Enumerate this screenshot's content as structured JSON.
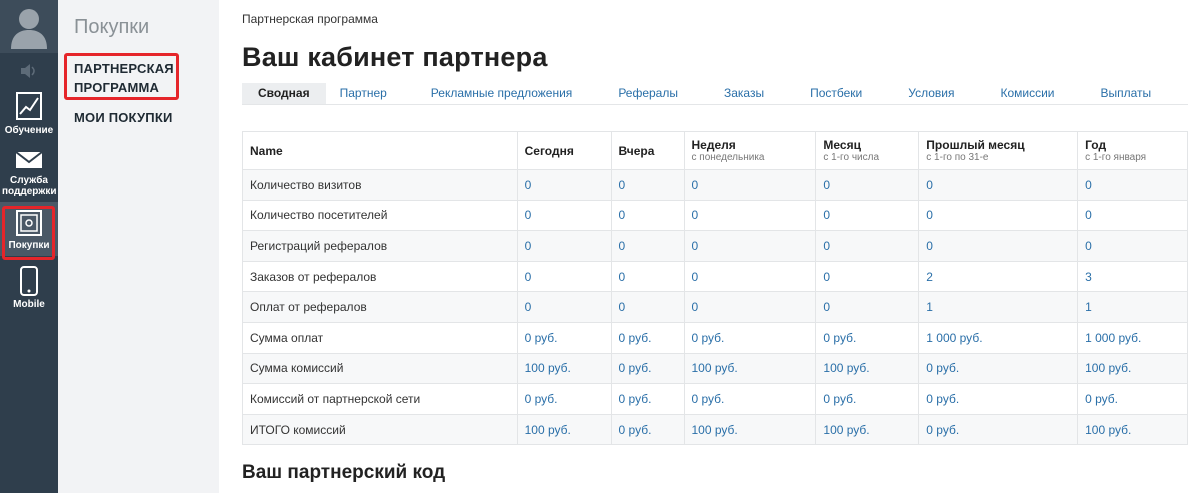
{
  "rail": {
    "items": [
      {
        "label": "Обучение",
        "icon": "chart-icon"
      },
      {
        "label": "Служба поддержки",
        "icon": "envelope-icon"
      },
      {
        "label": "Покупки",
        "icon": "safe-icon"
      },
      {
        "label": "Mobile",
        "icon": "mobile-icon"
      }
    ]
  },
  "sidebar": {
    "title": "Покупки",
    "items": [
      {
        "label_line1": "ПАРТНЕРСКАЯ",
        "label_line2": "ПРОГРАММА"
      },
      {
        "label": "МОИ ПОКУПКИ"
      }
    ]
  },
  "breadcrumb": "Партнерская программа",
  "page_title": "Ваш кабинет партнера",
  "tabs": [
    {
      "label": "Сводная",
      "active": true
    },
    {
      "label": "Партнер"
    },
    {
      "label": "Рекламные предложения"
    },
    {
      "label": "Рефералы"
    },
    {
      "label": "Заказы"
    },
    {
      "label": "Постбеки"
    },
    {
      "label": "Условия"
    },
    {
      "label": "Комиссии"
    },
    {
      "label": "Выплаты"
    }
  ],
  "table": {
    "headers": [
      {
        "label": "Name",
        "sub": ""
      },
      {
        "label": "Сегодня",
        "sub": ""
      },
      {
        "label": "Вчера",
        "sub": ""
      },
      {
        "label": "Неделя",
        "sub": "с понедельника"
      },
      {
        "label": "Месяц",
        "sub": "с 1-го числа"
      },
      {
        "label": "Прошлый месяц",
        "sub": "с 1-го по 31-е"
      },
      {
        "label": "Год",
        "sub": "с 1-го января"
      }
    ],
    "rows": [
      {
        "name": "Количество визитов",
        "values": [
          "0",
          "0",
          "0",
          "0",
          "0",
          "0"
        ]
      },
      {
        "name": "Количество посетителей",
        "values": [
          "0",
          "0",
          "0",
          "0",
          "0",
          "0"
        ]
      },
      {
        "name": "Регистраций рефералов",
        "values": [
          "0",
          "0",
          "0",
          "0",
          "0",
          "0"
        ]
      },
      {
        "name": "Заказов от рефералов",
        "values": [
          "0",
          "0",
          "0",
          "0",
          "2",
          "3"
        ]
      },
      {
        "name": "Оплат от рефералов",
        "values": [
          "0",
          "0",
          "0",
          "0",
          "1",
          "1"
        ]
      },
      {
        "name": "Сумма оплат",
        "values": [
          "0 руб.",
          "0 руб.",
          "0 руб.",
          "0 руб.",
          "1 000 руб.",
          "1 000 руб."
        ]
      },
      {
        "name": "Сумма комиссий",
        "values": [
          "100 руб.",
          "0 руб.",
          "100 руб.",
          "100 руб.",
          "0 руб.",
          "100 руб."
        ]
      },
      {
        "name": "Комиссий от партнерской сети",
        "values": [
          "0 руб.",
          "0 руб.",
          "0 руб.",
          "0 руб.",
          "0 руб.",
          "0 руб."
        ]
      },
      {
        "name": "ИТОГО комиссий",
        "values": [
          "100 руб.",
          "0 руб.",
          "100 руб.",
          "100 руб.",
          "0 руб.",
          "100 руб."
        ]
      }
    ]
  },
  "section_title": "Ваш партнерский код",
  "colors": {
    "rail_bg": "#2f3e4c",
    "link": "#2a6fa8",
    "highlight": "#e5252a"
  }
}
